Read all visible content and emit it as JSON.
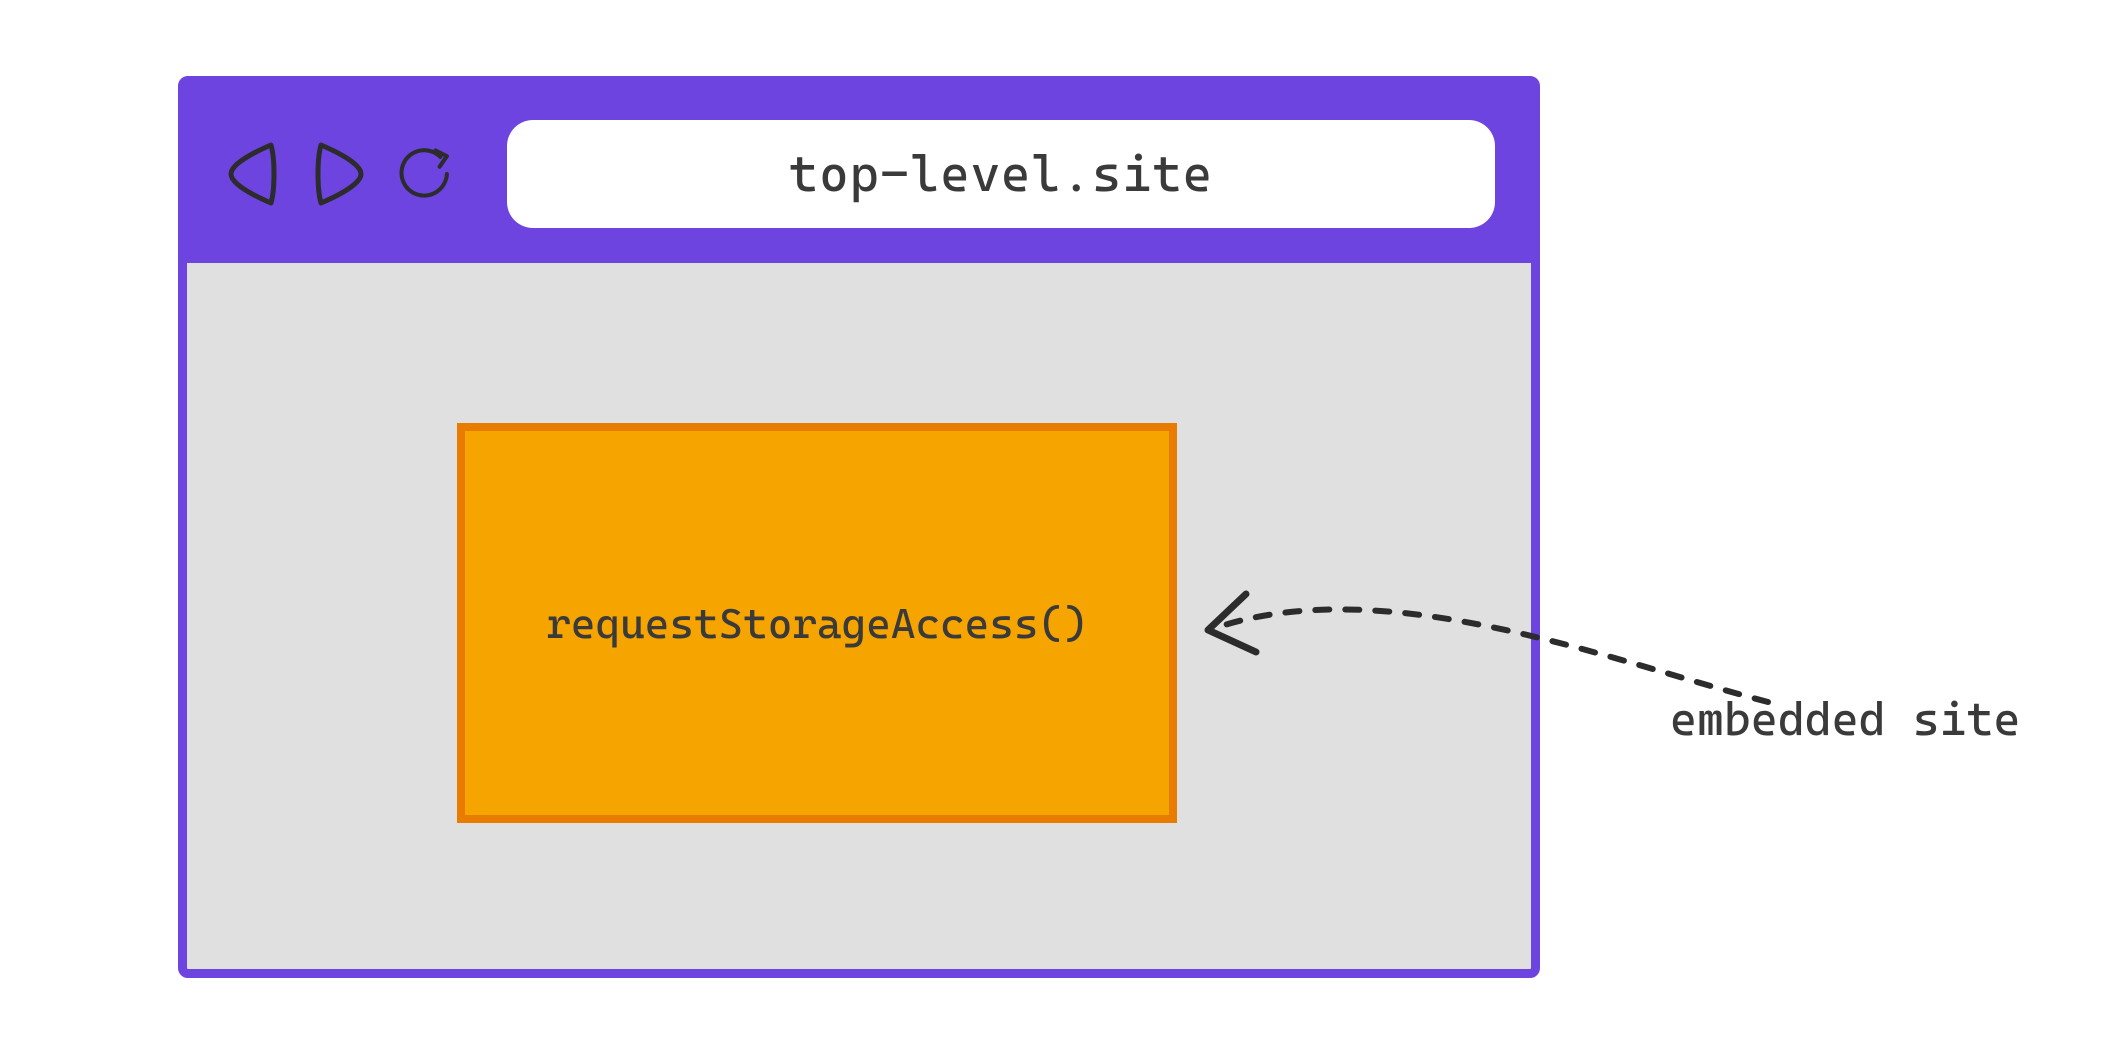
{
  "colors": {
    "browser_chrome": "#6E44E1",
    "viewport_background": "#E0E0E0",
    "embedded_fill": "#F6A500",
    "embedded_border": "#E87C00",
    "text": "#3a3a3a"
  },
  "address_bar": {
    "url": "top-level.site"
  },
  "nav_icons": {
    "back": "back-icon",
    "forward": "forward-icon",
    "reload": "reload-icon"
  },
  "embedded": {
    "code_text": "requestStorageAccess()"
  },
  "annotation": {
    "label": "embedded site"
  }
}
